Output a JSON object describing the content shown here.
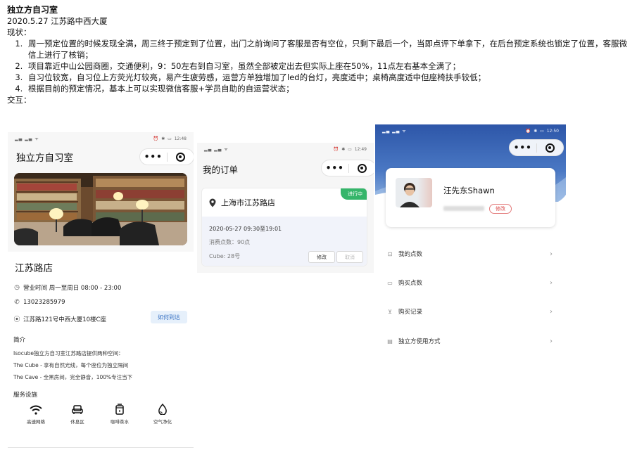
{
  "doc": {
    "title": "独立方自习室",
    "meta": "2020.5.27  江苏路中西大厦",
    "status_label": "现状：",
    "points": [
      "周一预定位置的时候发现全满，周三终于预定到了位置，出门之前询问了客服是否有空位，只剩下最后一个，当即点评下单拿下，在后台预定系统也锁定了位置，客服微信上进行了核销；",
      "项目靠近中山公园商圈，交通便利，9：50左右到自习室，虽然全部被定出去但实际上座在50%，11点左右基本全满了；",
      "自习位较宽，自习位上方荧光灯较亮，易产生疲劳感，运营方单独增加了led的台灯，亮度适中；桌椅高度适中但座椅扶手较低；",
      "根据目前的预定情况，基本上可以实现微信客服+学员自助的自运营状态；"
    ],
    "interaction_label": "交互："
  },
  "phone1": {
    "time": "12:48",
    "nav_title": "独立方自习室",
    "store_name": "江苏路店",
    "hours": "营业时间  周一至周日  08:00 - 23:00",
    "phone": "13023285979",
    "address": "江苏路121号中西大厦10楼C座",
    "howto": "如何到达",
    "intro_title": "简介",
    "intro_lines": [
      "Isocube独立方自习室江苏路店提供两种空间：",
      "The Cube - 享有自然光线，每个座位为独立隔间",
      "The Cave - 全黑房间，完全静音，100%专注当下"
    ],
    "facilities_title": "服务设施",
    "facilities": [
      {
        "label": "高速网络",
        "icon": "wifi-icon"
      },
      {
        "label": "休息区",
        "icon": "sofa-icon"
      },
      {
        "label": "咖啡茶水",
        "icon": "coffee-icon"
      },
      {
        "label": "空气净化",
        "icon": "water-drop-icon"
      }
    ]
  },
  "phone2": {
    "time": "12:49",
    "nav_title": "我的订单",
    "store": "上海市江苏路店",
    "badge": "进行中",
    "datetime": "2020-05-27 09:30至19:01",
    "points": "消费点数：90点",
    "cube": "Cube: 28号",
    "modify": "修改",
    "cancel": "取消"
  },
  "phone3": {
    "time": "12:50",
    "username": "汪先东Shawn",
    "edit": "修改",
    "menu": [
      {
        "label": "我的点数",
        "icon": "points-icon"
      },
      {
        "label": "购买点数",
        "icon": "card-icon"
      },
      {
        "label": "购买记录",
        "icon": "cart-icon"
      },
      {
        "label": "独立方使用方式",
        "icon": "book-icon"
      }
    ]
  }
}
